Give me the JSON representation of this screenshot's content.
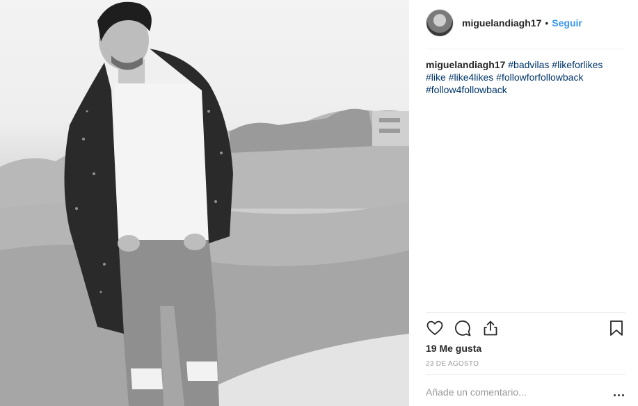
{
  "post": {
    "username": "miguelandiagh17",
    "separator": "•",
    "follow_label": "Seguir",
    "caption_user": "miguelandiagh17",
    "hashtags": [
      "#badvilas",
      "#likeforlikes",
      "#like",
      "#like4likes",
      "#followforfollowback",
      "#follow4followback"
    ],
    "likes_text": "19 Me gusta",
    "date_text": "23 DE AGOSTO",
    "comment_placeholder": "Añade un comentario...",
    "more_label": "..."
  },
  "icons": {
    "like": "heart-icon",
    "comment": "comment-bubble-icon",
    "share": "share-icon",
    "save": "bookmark-icon"
  },
  "colors": {
    "link_blue": "#3897f0",
    "hashtag": "#003569",
    "text": "#262626",
    "muted": "#999999"
  }
}
